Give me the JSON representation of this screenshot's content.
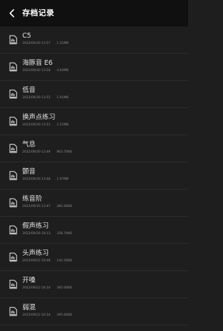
{
  "header": {
    "title": "存档记录"
  },
  "records": [
    {
      "name": "C5",
      "date": "2022/09/30 13:57",
      "size": "1.31MB"
    },
    {
      "name": "海豚音 E6",
      "date": "2022/09/30 13:56",
      "size": "4.64MB"
    },
    {
      "name": "低音",
      "date": "2022/09/30 13:55",
      "size": "1.01MB"
    },
    {
      "name": "换声点练习",
      "date": "2022/09/30 13:51",
      "size": "2.51MB"
    },
    {
      "name": "气息",
      "date": "2022/09/30 13:49",
      "size": "963.70KB"
    },
    {
      "name": "颤音",
      "date": "2022/09/30 13:48",
      "size": "1.97MB"
    },
    {
      "name": "练音阶",
      "date": "2022/09/30 13:47",
      "size": "485.00KB"
    },
    {
      "name": "假声练习",
      "date": "2022/09/28 18:13",
      "size": "328.70KB"
    },
    {
      "name": "头声练习",
      "date": "2022/09/22 16:48",
      "size": "142.50KB"
    },
    {
      "name": "开嗓",
      "date": "2022/09/22 16:34",
      "size": "395.00KB"
    },
    {
      "name": "弱混",
      "date": "2022/09/22 16:34",
      "size": "395.00KB"
    }
  ],
  "icons": {
    "back": "chevron-left-icon",
    "record": "audio-file-icon"
  },
  "colors": {
    "background": "#1e1e1e",
    "topbar": "#101010",
    "text": "#e4e4e4",
    "meta": "#8a8a8a"
  }
}
